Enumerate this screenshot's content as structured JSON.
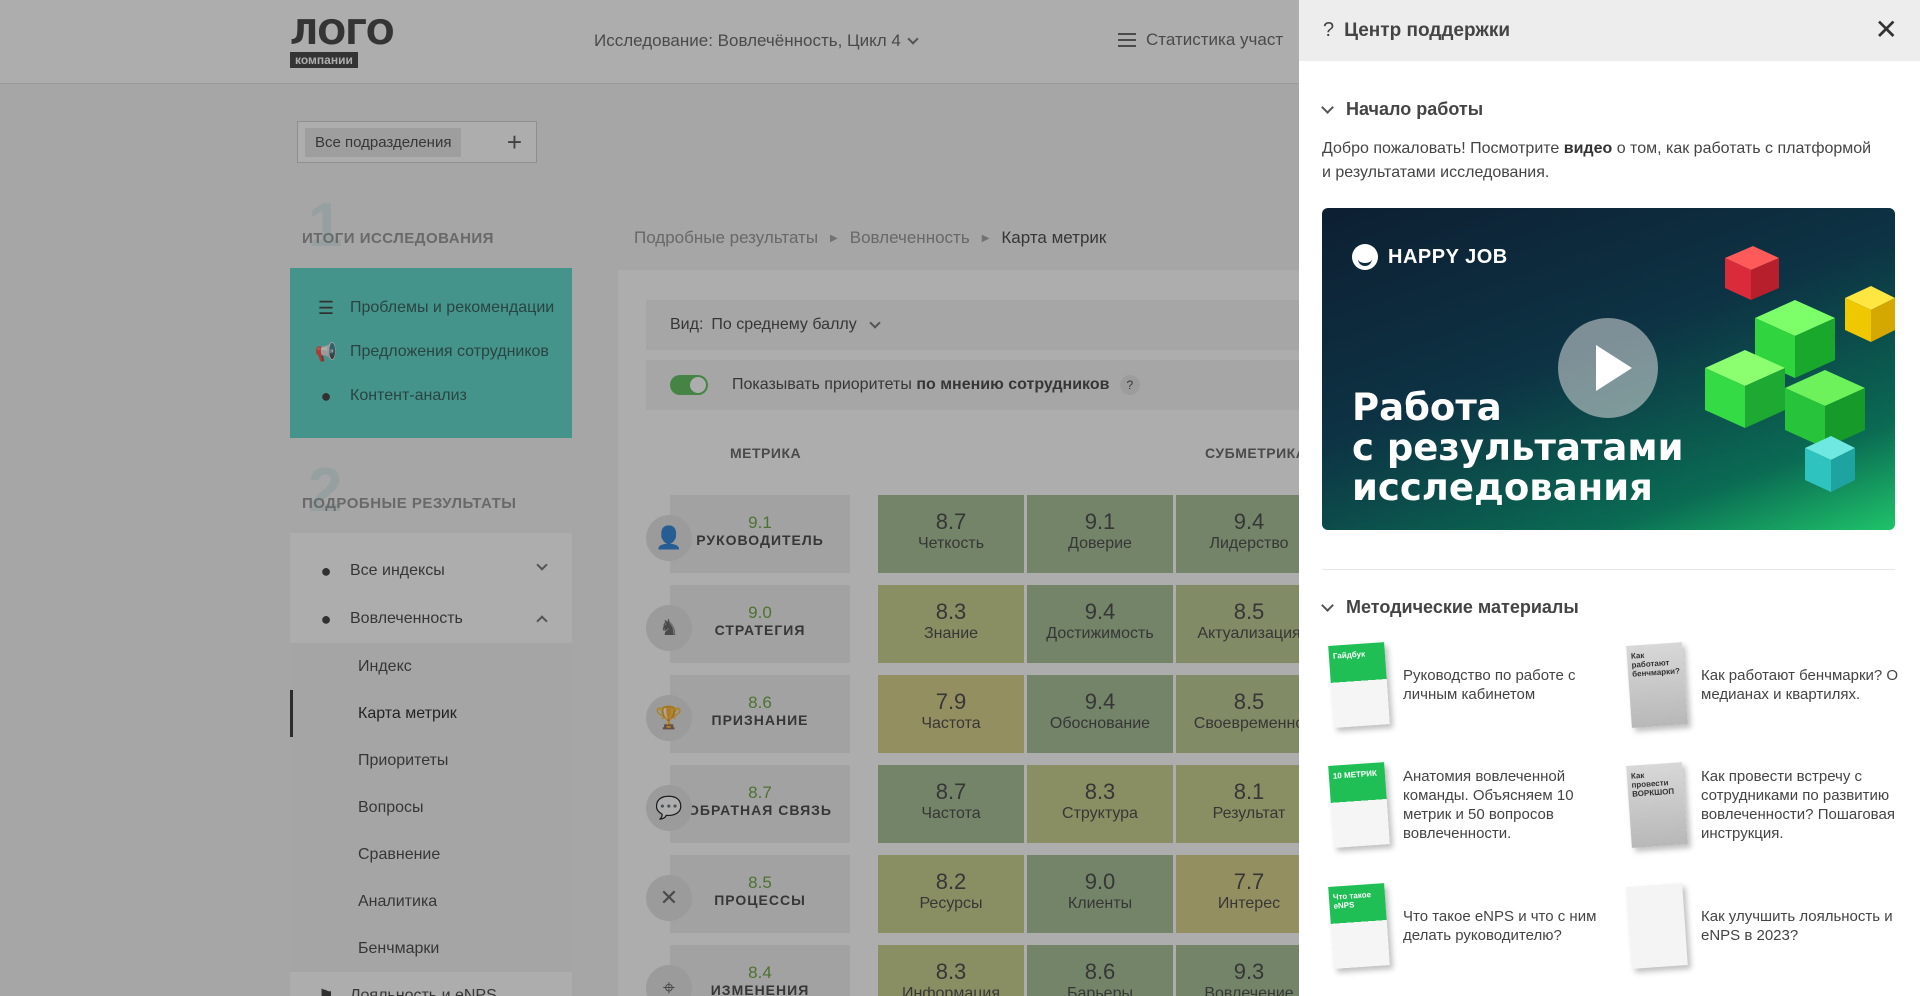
{
  "logo": {
    "main": "ЛОГО",
    "sub": "компании"
  },
  "header": {
    "study": "Исследование: Вовлечённость, Цикл 4",
    "stats": "Статистика участ"
  },
  "filter": {
    "division": "Все подразделения"
  },
  "sidebar": {
    "section1_num": "1",
    "section1_title": "ИТОГИ ИССЛЕДОВАНИЯ",
    "summary_items": [
      "Проблемы и рекомендации",
      "Предложения сотрудников",
      "Контент-анализ"
    ],
    "section2_num": "2",
    "section2_title": "ПОДРОБНЫЕ РЕЗУЛЬТАТЫ",
    "detail_items": [
      "Все индексы",
      "Вовлеченность"
    ],
    "sub_items": [
      "Индекс",
      "Карта метрик",
      "Приоритеты",
      "Вопросы",
      "Сравнение",
      "Аналитика",
      "Бенчмарки"
    ],
    "bottom_item": "Лояльность и eNPS"
  },
  "breadcrumb": [
    "Подробные результаты",
    "Вовлеченность",
    "Карта метрик"
  ],
  "main": {
    "view_label": "Вид:",
    "view_value": "По среднему баллу",
    "priority_text": "Показывать приоритеты",
    "priority_bold": "по мнению сотрудников",
    "col_metric": "МЕТРИКА",
    "col_submetric": "СУБМЕТРИКА",
    "rows": [
      {
        "icon": "person-icon",
        "score": "9.1",
        "name": "РУКОВОДИТЕЛЬ",
        "cells": [
          [
            "8.7",
            "Четкость",
            "#9db88a"
          ],
          [
            "9.1",
            "Доверие",
            "#9db88a"
          ],
          [
            "9.4",
            "Лидерство",
            "#9db88a"
          ]
        ]
      },
      {
        "icon": "chess-knight-icon",
        "score": "9.0",
        "name": "СТРАТЕГИЯ",
        "cells": [
          [
            "8.3",
            "Знание",
            "#c1cc80"
          ],
          [
            "9.4",
            "Достижимость",
            "#9db88a"
          ],
          [
            "8.5",
            "Актуализация",
            "#b3c484"
          ]
        ]
      },
      {
        "icon": "trophy-icon",
        "score": "8.6",
        "name": "ПРИЗНАНИЕ",
        "cells": [
          [
            "7.9",
            "Частота",
            "#d4cc7c"
          ],
          [
            "9.4",
            "Обоснование",
            "#9db88a"
          ],
          [
            "8.5",
            "Своевременно",
            "#b3c484"
          ]
        ]
      },
      {
        "icon": "chat-icon",
        "score": "8.7",
        "name": "ОБРАТНАЯ СВЯЗЬ",
        "cells": [
          [
            "8.7",
            "Частота",
            "#9db88a"
          ],
          [
            "8.3",
            "Структура",
            "#c1cc80"
          ],
          [
            "8.1",
            "Результат",
            "#c1cc80"
          ]
        ]
      },
      {
        "icon": "tools-icon",
        "score": "8.5",
        "name": "ПРОЦЕССЫ",
        "cells": [
          [
            "8.2",
            "Ресурсы",
            "#c1cc80"
          ],
          [
            "9.0",
            "Клиенты",
            "#9db88a"
          ],
          [
            "7.7",
            "Интерес",
            "#d4cc7c"
          ]
        ]
      },
      {
        "icon": "map-pin-icon",
        "score": "8.4",
        "name": "ИЗМЕНЕНИЯ",
        "cells": [
          [
            "8.3",
            "Информация",
            "#c1cc80"
          ],
          [
            "8.6",
            "Барьеры",
            "#9db88a"
          ],
          [
            "9.3",
            "Вовлечение",
            "#9db88a"
          ]
        ]
      }
    ]
  },
  "panel": {
    "title": "Центр поддержки",
    "start_title": "Начало работы",
    "welcome_pre": "Добро пожаловать! Посмотрите",
    "welcome_bold": "видео",
    "welcome_post": "о том, как работать с платформой и результатами исследования.",
    "video_brand": "HAPPY JOB",
    "video_title": [
      "Работа",
      "с результатами",
      "исследования"
    ],
    "materials_title": "Методические материалы",
    "materials": [
      {
        "text": "Руководство по работе с личным кабинетом",
        "cover": "green",
        "cover_text": "Гайдбук"
      },
      {
        "text": "Как работают бенчмарки? О медианах и квартилях.",
        "cover": "gray",
        "cover_text": "Как работают бенчмарки?"
      },
      {
        "text": "Анатомия вовлеченной команды. Объясняем 10 метрик и 50 вопросов вовлеченности.",
        "cover": "green",
        "cover_text": "10 МЕТРИК"
      },
      {
        "text": "Как провести встречу с сотрудниками по развитию вовлеченности? Пошаговая инструкция.",
        "cover": "gray",
        "cover_text": "Как провести ВОРКШОП"
      },
      {
        "text": "Что такое eNPS и что с ним делать руководителю?",
        "cover": "green",
        "cover_text": "Что такое eNPS"
      },
      {
        "text": "Как улучшить лояльность и eNPS в 2023?",
        "cover": "white",
        "cover_text": ""
      }
    ]
  }
}
